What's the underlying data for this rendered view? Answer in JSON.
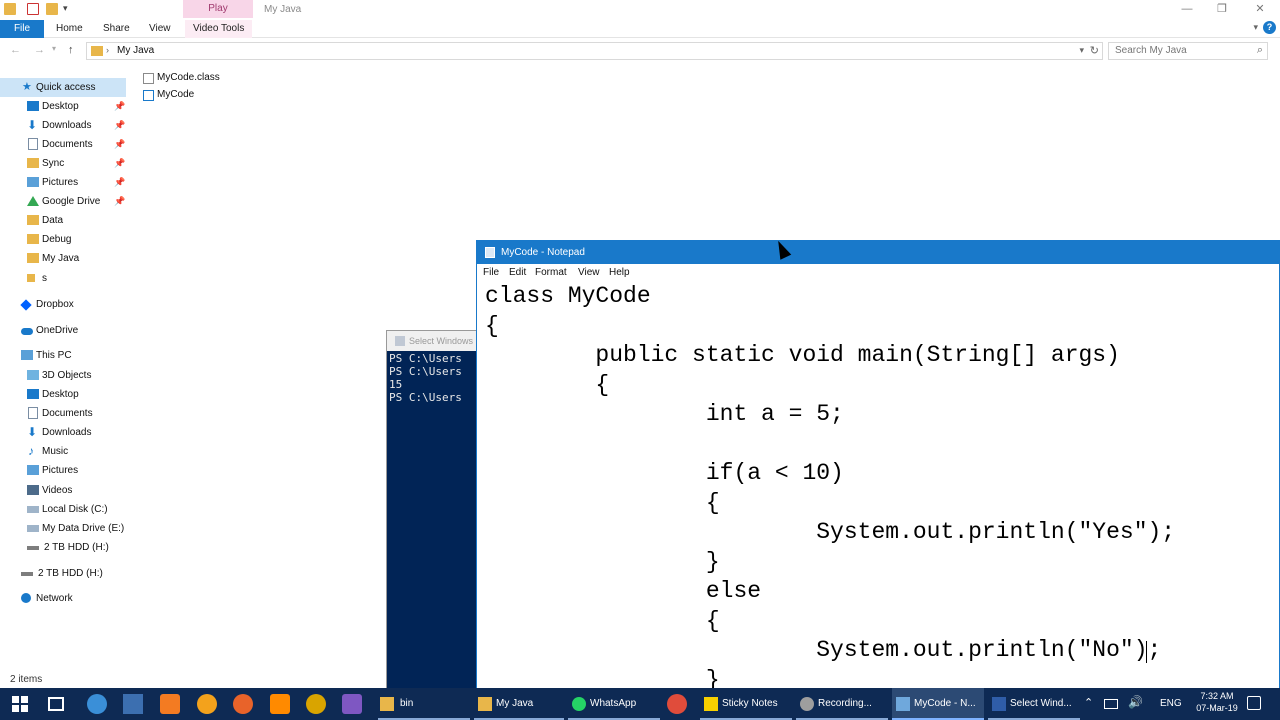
{
  "explorer": {
    "context_tab": "Play",
    "title": "My Java",
    "tabs": [
      {
        "label": "File"
      },
      {
        "label": "Home"
      },
      {
        "label": "Share"
      },
      {
        "label": "View"
      },
      {
        "label": "Video Tools"
      }
    ],
    "address": "My Java",
    "search_placeholder": "Search My Java",
    "nav": {
      "quick_access": "Quick access",
      "items": [
        {
          "label": "Desktop",
          "icon": "desktop-icon"
        },
        {
          "label": "Downloads",
          "icon": "download-icon"
        },
        {
          "label": "Documents",
          "icon": "document-icon"
        },
        {
          "label": "Sync",
          "icon": "folder-icon"
        },
        {
          "label": "Pictures",
          "icon": "picture-icon"
        },
        {
          "label": "Google Drive",
          "icon": "google-drive-icon"
        },
        {
          "label": "Data",
          "icon": "folder-icon"
        },
        {
          "label": "Debug",
          "icon": "folder-icon"
        },
        {
          "label": "My Java",
          "icon": "folder-icon"
        },
        {
          "label": "s",
          "icon": "folder-icon"
        }
      ],
      "dropbox": "Dropbox",
      "onedrive": "OneDrive",
      "this_pc": "This PC",
      "pc_items": [
        {
          "label": "3D Objects"
        },
        {
          "label": "Desktop"
        },
        {
          "label": "Documents"
        },
        {
          "label": "Downloads"
        },
        {
          "label": "Music"
        },
        {
          "label": "Pictures"
        },
        {
          "label": "Videos"
        },
        {
          "label": "Local Disk (C:)"
        },
        {
          "label": "My Data Drive (E:)"
        },
        {
          "label": "2 TB HDD (H:)"
        }
      ],
      "hdd": "2 TB HDD (H:)",
      "network": "Network"
    },
    "files": [
      {
        "name": "MyCode.class"
      },
      {
        "name": "MyCode"
      }
    ],
    "status": "2 items"
  },
  "powershell": {
    "title": "Select Windows",
    "lines": [
      "PS C:\\Users",
      "PS C:\\Users",
      "15",
      "PS C:\\Users"
    ]
  },
  "notepad": {
    "title": "MyCode - Notepad",
    "menu": [
      "File",
      "Edit",
      "Format",
      "View",
      "Help"
    ],
    "code": [
      "class MyCode",
      "{",
      "        public static void main(String[] args)",
      "        {",
      "                int a = 5;",
      "",
      "                if(a < 10)",
      "                {",
      "                        System.out.println(\"Yes\");",
      "                }",
      "                else",
      "                {",
      "                        System.out.println(\"No\");",
      "                }"
    ]
  },
  "taskbar": {
    "apps": [
      {
        "label": "bin"
      },
      {
        "label": "My Java"
      },
      {
        "label": "WhatsApp"
      },
      {
        "label": "Sticky Notes"
      },
      {
        "label": "Recording..."
      },
      {
        "label": "MyCode - N..."
      },
      {
        "label": "Select Wind..."
      }
    ],
    "lang": "ENG",
    "time": "7:32 AM",
    "date": "07-Mar-19"
  },
  "colors": {
    "accent": "#1979ca",
    "taskbar": "#0e2a54",
    "powershell_bg": "#012456"
  }
}
